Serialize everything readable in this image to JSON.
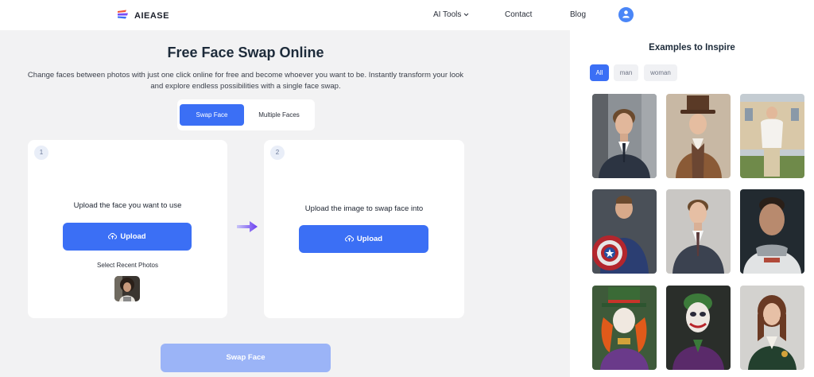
{
  "header": {
    "brand": "AIEASE",
    "nav": {
      "ai_tools": "AI Tools",
      "contact": "Contact",
      "blog": "Blog"
    }
  },
  "main": {
    "title": "Free Face Swap Online",
    "subtitle_line1": "Change faces between photos with just one click online for free and become whoever you want to be. Instantly transform your look",
    "subtitle_line2": "and explore endless possibilities with a single face swap.",
    "tabs": {
      "swap_face": "Swap Face",
      "multiple_faces": "Multiple Faces"
    },
    "card1": {
      "step": "1",
      "label": "Upload the face you want to use",
      "upload": "Upload",
      "recent": "Select Recent Photos"
    },
    "card2": {
      "step": "2",
      "label": "Upload the image to swap face into",
      "upload": "Upload"
    },
    "swap_button": "Swap Face"
  },
  "panel": {
    "title": "Examples to Inspire",
    "filters": {
      "all": "All",
      "man": "man",
      "woman": "woman"
    },
    "examples": [
      "businessman-in-office",
      "victorian-gentleman-top-hat",
      "man-in-white-shirt-mansion",
      "superhero-with-shield",
      "young-man-in-suit",
      "astronaut-portrait",
      "mad-hatter-portrait",
      "joker-portrait",
      "girl-in-school-uniform"
    ]
  },
  "colors": {
    "accent": "#3b6ff5",
    "accent_disabled": "#9bb4f7",
    "background": "#f2f2f3"
  }
}
